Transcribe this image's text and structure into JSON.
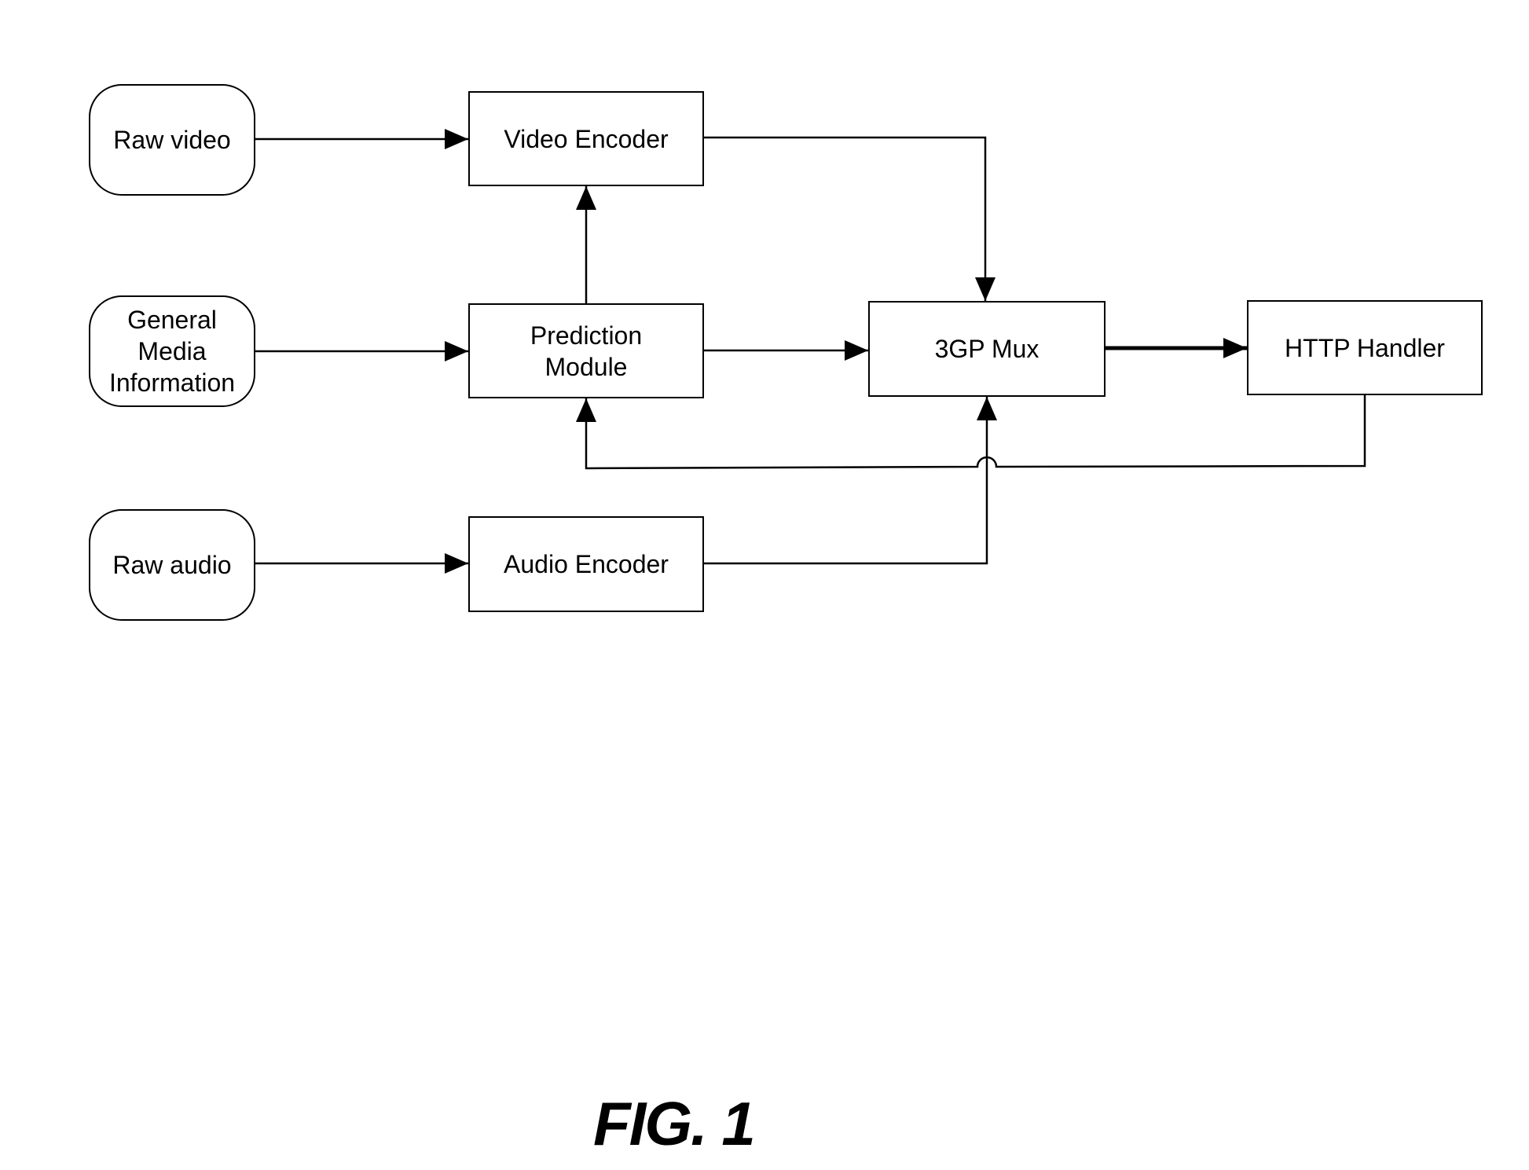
{
  "figure": {
    "caption": "FIG. 1"
  },
  "nodes": {
    "raw_video": "Raw video",
    "general_media_information": "General\nMedia\nInformation",
    "raw_audio": "Raw audio",
    "video_encoder": "Video Encoder",
    "prediction_module": "Prediction\nModule",
    "audio_encoder": "Audio Encoder",
    "mux": "3GP Mux",
    "http_handler": "HTTP Handler"
  },
  "edges": [
    {
      "from": "Raw video",
      "to": "Video Encoder"
    },
    {
      "from": "General Media Information",
      "to": "Prediction Module"
    },
    {
      "from": "Raw audio",
      "to": "Audio Encoder"
    },
    {
      "from": "Prediction Module",
      "to": "Video Encoder"
    },
    {
      "from": "Video Encoder",
      "to": "3GP Mux"
    },
    {
      "from": "Prediction Module",
      "to": "3GP Mux"
    },
    {
      "from": "Audio Encoder",
      "to": "3GP Mux"
    },
    {
      "from": "3GP Mux",
      "to": "HTTP Handler"
    },
    {
      "from": "HTTP Handler",
      "to": "Prediction Module"
    }
  ]
}
